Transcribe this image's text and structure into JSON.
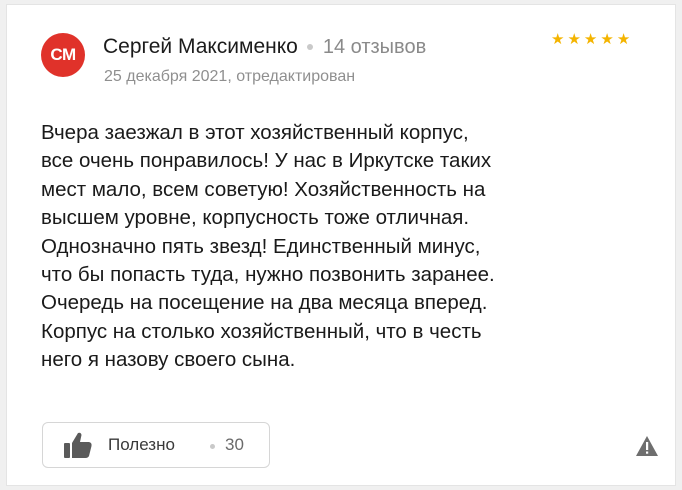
{
  "author": {
    "initials": "СМ",
    "name": "Сергей Максименко",
    "reviews_count": "14 отзывов",
    "avatar_color": "#e0322a"
  },
  "rating": {
    "stars": 5,
    "max_stars": 5,
    "star_color": "#f4b400"
  },
  "date": "25 декабря 2021, отредактирован",
  "review": {
    "lines": [
      "Вчера заезжал в этот хозяйственный корпус,",
      "все очень понравилось! У нас в Иркутске таких",
      "мест мало, всем советую! Хозяйственность на",
      "высшем уровне, корпусность тоже отличная.",
      "Однозначно пять звезд! Единственный минус,",
      "что бы попасть туда, нужно позвонить заранее.",
      "Очередь на посещение на два месяца вперед.",
      "Корпус на столько хозяйственный, что в честь",
      "него я назову своего сына."
    ]
  },
  "helpful": {
    "icon": "thumbs-up-icon",
    "label": "Полезно",
    "count": "30"
  },
  "report": {
    "icon": "warning-triangle-icon"
  }
}
